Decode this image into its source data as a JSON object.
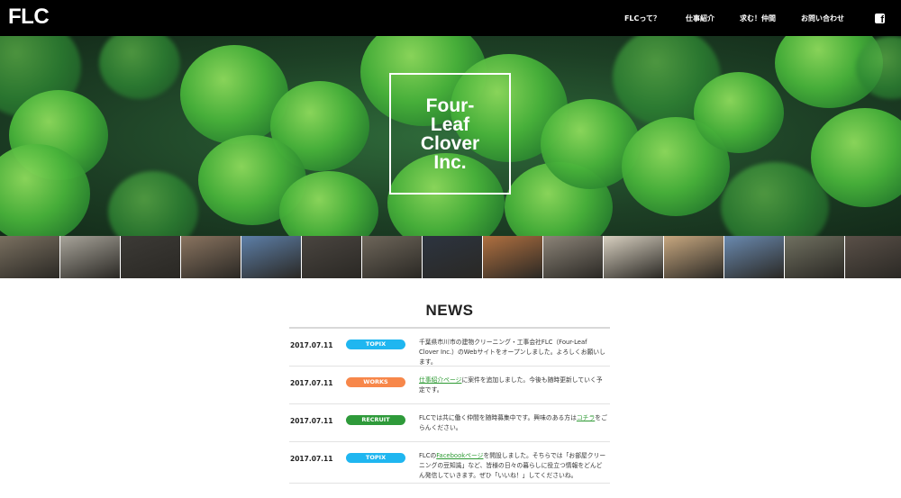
{
  "header": {
    "logo": "FLC",
    "nav": [
      "FLCって？",
      "仕事紹介",
      "求む！仲間",
      "お問い合わせ"
    ]
  },
  "hero": {
    "title_lines": [
      "Four-",
      "Leaf",
      "Clover",
      "Inc."
    ]
  },
  "strip": {
    "tiles": [
      "#7a7060",
      "#a8a49a",
      "#3c3a36",
      "#8a7460",
      "#5d7fa8",
      "#4a4540",
      "#6e665a",
      "#2c3440",
      "#b07040",
      "#8c8478",
      "#d8d0c0",
      "#c8a880",
      "#6a8ab0",
      "#707060",
      "#5a5048"
    ]
  },
  "colors": {
    "topix": "#1fb6f0",
    "works": "#f7874a",
    "recruit": "#2e9a3a",
    "link": "#2d9a33"
  },
  "news": {
    "title": "NEWS",
    "items": [
      {
        "date": "2017.07.11",
        "badge": "TOPIX",
        "color": "#1fb6f0",
        "text_before": "千葉県市川市の建物クリーニング・工事会社FLC（Four-Leaf Clover Inc.）のWebサイトをオープンしました。よろしくお願いします。",
        "link": "",
        "text_after": ""
      },
      {
        "date": "2017.07.11",
        "badge": "WORKS",
        "color": "#f7874a",
        "text_before": "",
        "link": "仕事紹介ページ",
        "text_after": "に案件を追加しました。今後も随時更新していく予定です。"
      },
      {
        "date": "2017.07.11",
        "badge": "RECRUIT",
        "color": "#2e9a3a",
        "text_before": "FLCでは共に働く仲間を随時募集中です。興味のある方は",
        "link": "コチラ",
        "text_after": "をごらんください。"
      },
      {
        "date": "2017.07.11",
        "badge": "TOPIX",
        "color": "#1fb6f0",
        "text_before": "FLCの",
        "link": "Facebookページ",
        "text_after": "を開設しました。そちらでは「お部屋クリーニングの豆知識」など、皆様の日々の暮らしに役立つ情報をどんどん発信していきます。ぜひ「いいね！」してくださいね。"
      }
    ]
  }
}
